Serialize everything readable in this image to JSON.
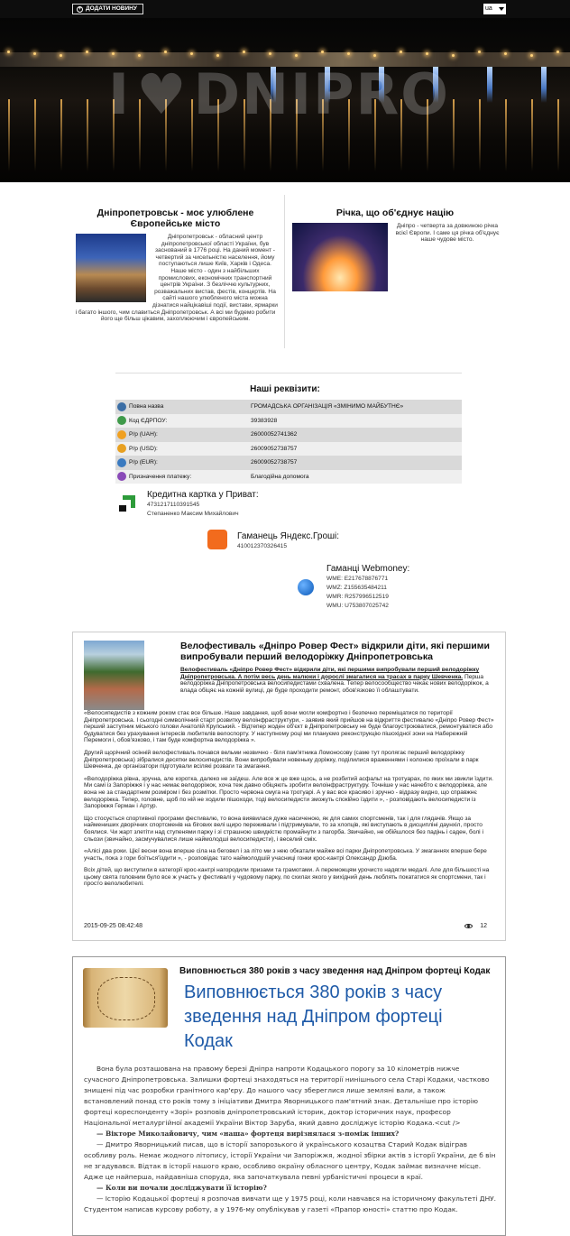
{
  "topbar": {
    "add_news_label": "ДОДАТИ НОВИНУ",
    "lang": "ua"
  },
  "hero": {
    "logo": "DNIPRO"
  },
  "intro": [
    {
      "title": "Дніпропетровськ - моє улюблене Європейське місто",
      "text": "Дніпропетровськ - обласний центр дніпропетровської області України, був заснований в 1776 році. На даний момент - четвертий за чисельністю населення, йому поступаються лише Київ, Харків і Одеса. Наше місто - один з найбільших промислових, економічних транспортний центрів України. З безліччю культурних, розважальних вистав, фестів, концертів. На сайті нашого улюбленого міста можна дізнатися найцікавіші події, вистави, ярмарки і багато іншого, чим славиться Дніпропетровськ. А всі ми будемо робити його ще більш цікавим, захоплюючим і європейським."
    },
    {
      "title": "Річка, що об'єднує націю",
      "text": "Дніпро - четверта за довжиною річка всієї Європи. І саме ця річка об'єднує наше чудове місто."
    }
  ],
  "requisites": {
    "title": "Наші реквізити:",
    "rows": [
      {
        "icon": "building-icon",
        "color": "#3b6ea5",
        "label": "Повна назва",
        "value": "ГРОМАДСЬКА ОРГАНІЗАЦІЯ «ЗМІНИМО МАЙБУТНЄ»"
      },
      {
        "icon": "globe-icon",
        "color": "#3f9a4a",
        "label": "Код ЄДРПОУ:",
        "value": "39383928"
      },
      {
        "icon": "hryvnia-icon",
        "color": "#f0a020",
        "label": "Р/р (UAH):",
        "value": "26000052741362"
      },
      {
        "icon": "dollar-icon",
        "color": "#e8a020",
        "label": "Р/р (USD):",
        "value": "26009052738757"
      },
      {
        "icon": "euro-icon",
        "color": "#3a7ac0",
        "label": "Р/р (EUR):",
        "value": "26009052738757"
      },
      {
        "icon": "purpose-icon",
        "color": "#8a4ab8",
        "label": "Призначення платежу:",
        "value": "Благодійна допомога"
      }
    ]
  },
  "payments": {
    "privat": {
      "title": "Кредитна картка у Приват:",
      "number": "4731217110391545",
      "name": "Степаненко Максим Михайлович"
    },
    "yandex": {
      "title": "Гаманець Яндекс.Гроші:",
      "number": "410012370326415"
    },
    "webmoney": {
      "title": "Гаманці Webmoney:",
      "wallets": [
        "WME: E217678876771",
        "WMZ: Z155635484211",
        "WMR: R257996512519",
        "WMU: U753807025742"
      ]
    }
  },
  "article1": {
    "title": "Велофестиваль «Дніпро Ровер Фест» відкрили діти, які першими випробували перший велодоріжку Дніпропетровська",
    "lead_link": "Велофестиваль «Дніпро Ровер Фест» відкрили діти, які першими випробували перший велодоріжку Дніпропетровська. А потім весь день малюки і дорослі змагалися на трасах в парку Шевченка.",
    "lead_rest": "Перша велодоріжка Дніпропетровська велосипедистами схвалена. Тепер велосообщество чекає нових велодоріжок, а влада обіцяє на кожній вулиці, де буде проходити ремонт, обов'язково її облаштувати.",
    "paragraphs": [
      "«Велосипедистів з кожним роком стає все більше. Наше завдання, щоб вони могли комфортно і безпечно переміщатися по території Дніпропетровська. І сьогодні символічний старт розвитку велоінфраструктури, - заявив який прийшов на відкриття фестивалю «Дніпро Ровер Фест» перший заступник міського голови Анатолій Крупський. - Відтепер жоден об'єкт в Дніпропетровську не буде благоустроюватися, ремонтуватися або будуватися без урахування інтересів любителів велоспорту. У наступному році ми плануємо реконструкцію пішохідної зони на Набережній Перемоги і, обов'язково, і там буде комфортна велодоріжка ».",
      "Другий щорічний осінній велофестиваль почався вельми незвично - біля пам'ятника Ломоносову (саме тут пролягає перший велодоріжку Дніпропетровська) зібралися десятки велосипедистів. Вони випробували новеньку доріжку, поділилися враженнями і колоною проїхали в парк Шевченка, де організатори підготували всілякі розваги та змагання.",
      "«Велодоріжка рівна, зручна, але коротка, далеко не заїдеш. Але все ж це вже щось, а не розбитий асфальт на тротуарах, по яких ми звикли їздити. Ми самі із Запоріжжя і у нас немає велодоріжок, хоча теж давно обіцяють зробити велоінфраструктуру. Точніше у нас начебто є велодоріжка, але вона не за стандартним розміром і без розмітки. Просто червона смуга на тротуарі. А у вас все красиво і зручно - відразу видно, що справжнє велодоріжка. Тепер, головне, щоб по ній не ходили пішоходи, тоді велосипедисти зможуть спокійно їздити », - розповідають велосипедисти із Запоріжжя Герман і Артур.",
      "Що стосується спортивної програми фестивалю, то вона виявилася дуже насиченою, як для самих спортсменів, так і для глядачів. Якщо за наймениших дворічних спортсменів на бігових велі щиро переживали і підтримували, то за хлопців, які виступають в дисципліні даунхіл, просто боялися. Чи жарт злетіти над ступенями парку і зі страшною швидкістю промайнути з пагорба. Звичайно, не обійшлося без падінь і саден, болі і сльози (звичайно, засмучувалися лише наймолодші велосипедисти), і веселий сміх.",
      "«Алісі два роки. Цієї весни вона вперше сіла на беговел і за літо ми з нею обкатали майже всі парки Дніпропетровська. У змаганнях вперше бере участь, пока з гори боїться'їздити », - розповідає тато наймолодшій учасниці гонки крос-кантрі Олександр Дзюба.",
      "Всіх дітей, що виступили в категорії крос-кантрі нагородили призами та грамотами. А переможцям урочисто надягли медалі. Але для більшості на цьому свята головним було все ж участь у фестивалі у чудовому парку, по схилах якого у вихідний день люблять покататися як спортсмени, так і просто велолюбителі."
    ],
    "date": "2015-09-25 08:42:48",
    "views": "12"
  },
  "article2": {
    "title": "Виповнюється 380 років з часу зведення над Дніпром фортеці Кодак",
    "big_title": "Виповнюється 380 років з часу зведення над Дніпром фортеці Кодак",
    "p1": "Вона була розташована на правому березі Дніпра напроти Кодацького порогу за 10 кілометрів нижче сучасного Дніпропетровська. Залишки фортеці знаходяться на території нинішнього села Старі Кодаки, частково знищені під час розробки гранітного кар'єру. До нашого часу збереглися лише земляні вали, а також встановлений понад сто років тому з ініціативи Дмитра Яворницького пам'ятний знак. Детальніше про історію фортеці кореспонденту «Зорі» розповів дніпропетровський історик, доктор історичних наук, професор Національної металургійної академії України Віктор Заруба, який давно досліджує історію Кодака.<cut />",
    "q1": "— Вікторе Миколайовичу, чим «наша» фортеця вирізнялася з-поміж інших?",
    "p2": "— Дмитро Яворницький писав, що в історії запорозького й українського козацтва Старий Кодак відіграв особливу роль. Немає жодного літопису, історії України чи Запоріжжя, жодної збірки актів з історії України, де б він не згадувався. Відтак в історії нашого краю, особливо окраїну обласного центру, Кодак займає визначне місце. Адже це найперша, найдавніша споруда, яка започаткувала певні урбаністичні процеси в краї.",
    "q2": "— Коли ви почали досліджувати її історію?",
    "p3": "— Історію Кодацької фортеці я розпочав вивчати ще у 1975 році, коли навчався на історичному факультеті ДНУ. Студентом написав курсову роботу, а у 1976-му опублікував у газеті «Прапор юності» статтю про Кодак."
  }
}
